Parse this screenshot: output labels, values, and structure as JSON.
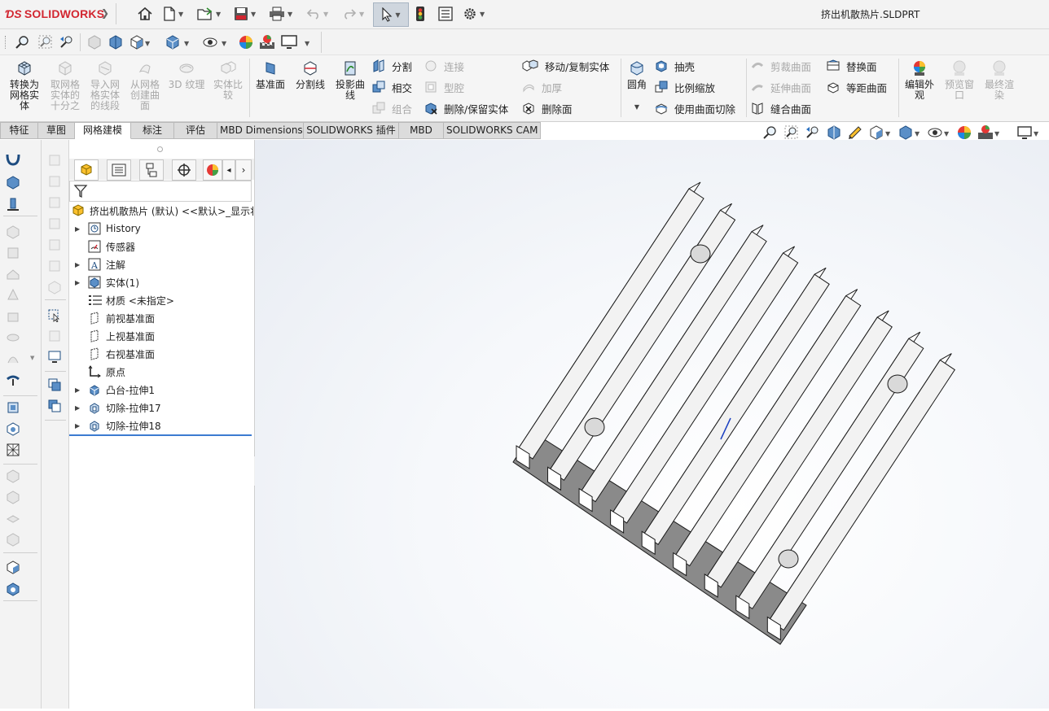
{
  "titlebar": {
    "logo_text": "SOLIDWORKS",
    "document_title": "挤出机散热片.SLDPRT"
  },
  "command_manager": {
    "mesh_tools": [
      {
        "label": "转换为\n网格实\n体",
        "enabled": true
      },
      {
        "label": "取网格\n实体的\n十分之",
        "enabled": false
      },
      {
        "label": "导入网\n格实体\n的线段",
        "enabled": false
      },
      {
        "label": "从网格\n创建曲\n面",
        "enabled": false
      },
      {
        "label": "3D 纹理",
        "enabled": false
      },
      {
        "label": "实体比\n较",
        "enabled": false
      }
    ],
    "ref_tools": [
      {
        "label": "基准面",
        "enabled": true
      },
      {
        "label": "分割线",
        "enabled": true
      },
      {
        "label": "投影曲\n线",
        "enabled": true
      }
    ],
    "col_a": [
      {
        "label": "分割",
        "enabled": true
      },
      {
        "label": "相交",
        "enabled": true
      },
      {
        "label": "组合",
        "enabled": false
      }
    ],
    "col_b": [
      {
        "label": "连接",
        "enabled": false
      },
      {
        "label": "型腔",
        "enabled": false
      },
      {
        "label": "删除/保留实体",
        "enabled": true
      }
    ],
    "col_c": [
      {
        "label": "移动/复制实体",
        "enabled": true
      },
      {
        "label": "加厚",
        "enabled": false
      },
      {
        "label": "删除面",
        "enabled": true
      }
    ],
    "fillet": {
      "label": "圆角"
    },
    "col_d": [
      {
        "label": "抽壳",
        "enabled": true
      },
      {
        "label": "比例缩放",
        "enabled": true
      },
      {
        "label": "使用曲面切除",
        "enabled": true
      }
    ],
    "col_e": [
      {
        "label": "剪裁曲面",
        "enabled": false
      },
      {
        "label": "延伸曲面",
        "enabled": false
      },
      {
        "label": "缝合曲面",
        "enabled": true
      }
    ],
    "col_f": [
      {
        "label": "替换面",
        "enabled": true
      },
      {
        "label": "等距曲面",
        "enabled": true
      }
    ],
    "render_tools": [
      {
        "label": "编辑外\n观",
        "enabled": true
      },
      {
        "label": "预览窗\n口",
        "enabled": false
      },
      {
        "label": "最终渲\n染",
        "enabled": false
      }
    ]
  },
  "tabs": [
    "特征",
    "草图",
    "网格建模",
    "标注",
    "评估",
    "MBD Dimensions",
    "SOLIDWORKS 插件",
    "MBD",
    "SOLIDWORKS CAM"
  ],
  "active_tab": "网格建模",
  "feature_tree": {
    "root": "挤出机散热片 (默认) <<默认>_显示状",
    "items": [
      {
        "label": "History",
        "icon": "history-icon",
        "expandable": true
      },
      {
        "label": "传感器",
        "icon": "sensor-icon",
        "expandable": false
      },
      {
        "label": "注解",
        "icon": "annotation-icon",
        "expandable": true
      },
      {
        "label": "实体(1)",
        "icon": "solid-body-icon",
        "expandable": true
      },
      {
        "label": "材质 <未指定>",
        "icon": "material-icon",
        "expandable": false
      },
      {
        "label": "前视基准面",
        "icon": "plane-icon",
        "expandable": false
      },
      {
        "label": "上视基准面",
        "icon": "plane-icon",
        "expandable": false
      },
      {
        "label": "右视基准面",
        "icon": "plane-icon",
        "expandable": false
      },
      {
        "label": "原点",
        "icon": "origin-icon",
        "expandable": false
      },
      {
        "label": "凸台-拉伸1",
        "icon": "boss-extrude-icon",
        "expandable": true
      },
      {
        "label": "切除-拉伸17",
        "icon": "cut-extrude-icon",
        "expandable": true
      },
      {
        "label": "切除-拉伸18",
        "icon": "cut-extrude-icon",
        "expandable": true
      }
    ]
  },
  "colors": {
    "accent": "#3c7bd1",
    "brand_red": "#d22630",
    "model_face": "#f2f2f2",
    "model_base": "#8a8a8a",
    "model_edge": "#1a1a1a"
  }
}
